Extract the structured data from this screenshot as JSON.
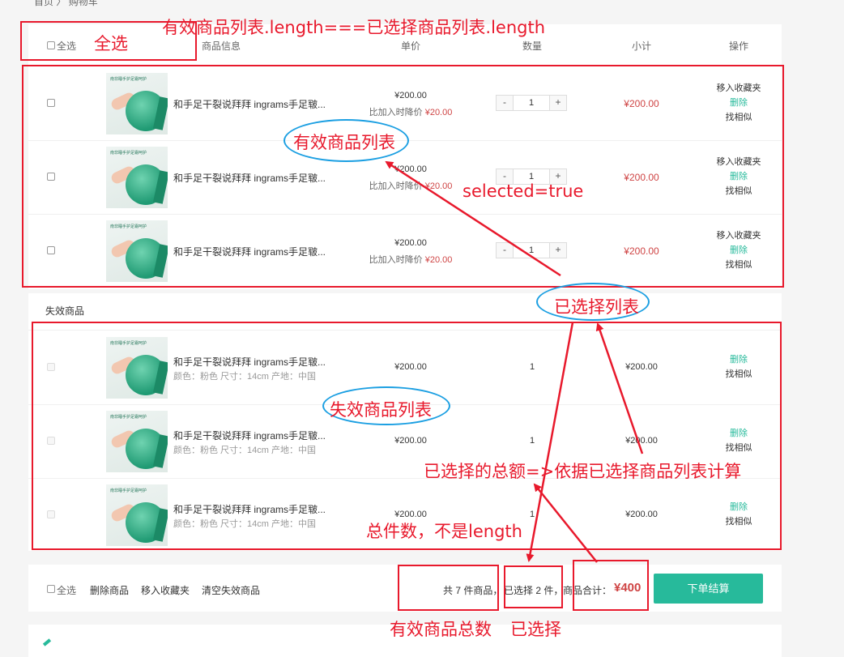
{
  "breadcrumb": [
    "首页",
    "购物车"
  ],
  "table_header": {
    "select_all": "全选",
    "info": "商品信息",
    "unit_price": "单价",
    "quantity": "数量",
    "subtotal": "小计",
    "actions": "操作"
  },
  "valid_items": [
    {
      "name": "和手足干裂说拜拜 ingrams手足皲...",
      "price": "¥200.00",
      "drop_prefix": "比加入时降价",
      "drop_amount": "¥20.00",
      "qty": "1",
      "subtotal": "¥200.00",
      "op_fav": "移入收藏夹",
      "op_delete": "删除",
      "op_similar": "找相似"
    },
    {
      "name": "和手足干裂说拜拜 ingrams手足皲...",
      "price": "¥200.00",
      "drop_prefix": "比加入时降价",
      "drop_amount": "¥20.00",
      "qty": "1",
      "subtotal": "¥200.00",
      "op_fav": "移入收藏夹",
      "op_delete": "删除",
      "op_similar": "找相似"
    },
    {
      "name": "和手足干裂说拜拜 ingrams手足皲...",
      "price": "¥200.00",
      "drop_prefix": "比加入时降价",
      "drop_amount": "¥20.00",
      "qty": "1",
      "subtotal": "¥200.00",
      "op_fav": "移入收藏夹",
      "op_delete": "删除",
      "op_similar": "找相似"
    }
  ],
  "invalid_section": {
    "title": "失效商品"
  },
  "invalid_items": [
    {
      "name": "和手足干裂说拜拜 ingrams手足皲...",
      "attrs": "颜色：粉色 尺寸：14cm 产地：中国",
      "price": "¥200.00",
      "qty": "1",
      "subtotal": "¥200.00",
      "op_delete": "删除",
      "op_similar": "找相似"
    },
    {
      "name": "和手足干裂说拜拜 ingrams手足皲...",
      "attrs": "颜色：粉色 尺寸：14cm 产地：中国",
      "price": "¥200.00",
      "qty": "1",
      "subtotal": "¥200.00",
      "op_delete": "删除",
      "op_similar": "找相似"
    },
    {
      "name": "和手足干裂说拜拜 ingrams手足皲...",
      "attrs": "颜色：粉色 尺寸：14cm 产地：中国",
      "price": "¥200.00",
      "qty": "1",
      "subtotal": "¥200.00",
      "op_delete": "删除",
      "op_similar": "找相似"
    }
  ],
  "product_image_caption": "南非睡手护足霜呵护",
  "footer": {
    "select_all": "全选",
    "delete": "删除商品",
    "move_fav": "移入收藏夹",
    "clear_invalid": "清空失效商品",
    "total_count": "共 7 件商品，",
    "selected_count": "已选择 2 件，",
    "total_label": "商品合计：",
    "total_amount": "¥400",
    "checkout": "下单结算"
  },
  "annotations": {
    "header_formula": "有效商品列表.length===已选择商品列表.length",
    "select_all": "全选",
    "valid_list": "有效商品列表",
    "selected_true": "selected=true",
    "selected_list": "已选择列表",
    "invalid_list": "失效商品列表",
    "selected_total": "已选择的总额=>依据已选择商品列表计算",
    "total_pieces": "总件数，不是length",
    "valid_total": "有效商品总数",
    "selected": "已选择"
  },
  "colors": {
    "accent": "#27ba9b",
    "price_red": "#cf4444",
    "annotation_red": "#e8192c",
    "ellipse_blue": "#1b9fe2"
  }
}
